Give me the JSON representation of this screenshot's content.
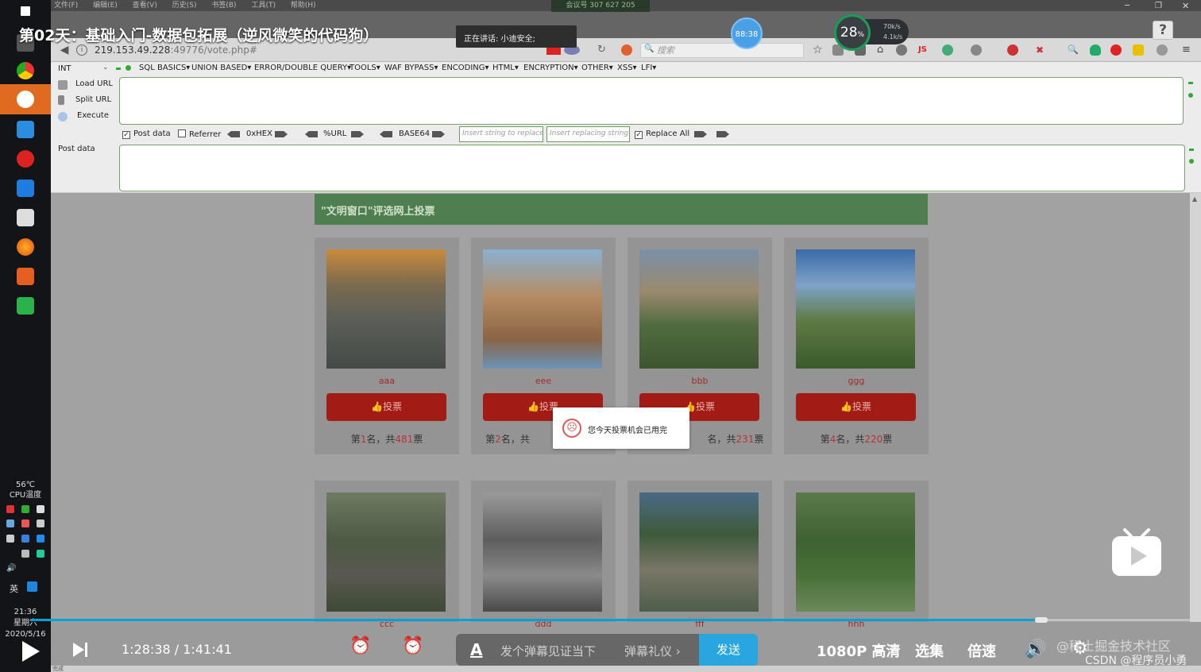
{
  "video": {
    "title": "第02天：基础入门-数据包拓展（逆风微笑的代码狗）",
    "current_time": "1:28:38",
    "time_sep": "/",
    "total_time": "1:41:41",
    "progress": 0.872,
    "barrage_placeholder": "发个弹幕见证当下",
    "barrage_gift": "弹幕礼仪 ›",
    "send_label": "发送",
    "quality_label": "1080P 高清",
    "episodes_label": "选集",
    "speed_label": "倍速",
    "watermark_top": "@稀土掘金技术社区",
    "watermark_bottom": "CSDN @程序员小勇"
  },
  "overlays": {
    "speaking": "正在讲话: 小迪安全;",
    "meeting_id": "会议号 307 627 205",
    "timer": "88:38",
    "speed_pct": "28",
    "speed_unit": "%",
    "net_up": "70k/s",
    "net_down": "4.1k/s",
    "help": "?"
  },
  "browser": {
    "menu": [
      "文件(F)",
      "编辑(E)",
      "查看(V)",
      "历史(S)",
      "书签(B)",
      "工具(T)",
      "帮助(H)"
    ],
    "url_host": "219.153.49.228",
    "url_path": ":49776/vote.php#",
    "search_placeholder": "搜索",
    "status": "完成"
  },
  "hackbar": {
    "select": "INT",
    "menus": [
      "SQL BASICS▾",
      "UNION BASED▾",
      "ERROR/DOUBLE QUERY▾",
      "TOOLS▾",
      "WAF BYPASS▾",
      "ENCODING▾",
      "HTML▾",
      "ENCRYPTION▾",
      "OTHER▾",
      "XSS▾",
      "LFI▾"
    ],
    "load_url": "Load URL",
    "split_url": "Split URL",
    "execute": "Execute",
    "post_data_cb": "Post data",
    "referrer_cb": "Referrer",
    "hex": "0xHEX",
    "urlenc": "%URL",
    "base64": "BASE64",
    "insert_placeholder": "Insert string to replace",
    "replace_placeholder": "Insert replacing string",
    "replace_all": "Replace All",
    "post_label": "Post data",
    "post_data_checked": true,
    "referrer_checked": false,
    "replace_all_checked": true
  },
  "page": {
    "banner": "\"文明窗口\"评选网上投票",
    "vote_label": "👍投票",
    "toast": "您今天投票机会已用完",
    "rank_prefix": "第",
    "rank_mid": "名，共",
    "rank_suffix": "票",
    "candidates": [
      {
        "name": "aaa",
        "rank": "1",
        "votes": "481"
      },
      {
        "name": "eee",
        "rank": "2",
        "votes": ""
      },
      {
        "name": "bbb",
        "rank": "",
        "votes": "231"
      },
      {
        "name": "ggg",
        "rank": "4",
        "votes": "220"
      },
      {
        "name": "ccc"
      },
      {
        "name": "ddd"
      },
      {
        "name": "fff"
      },
      {
        "name": "hhh"
      }
    ]
  },
  "taskbar": {
    "cpu_temp": "56℃",
    "cpu_label": "CPU温度",
    "ime": "英",
    "time": "21:36",
    "weekday": "星期六",
    "date": "2020/5/16"
  }
}
